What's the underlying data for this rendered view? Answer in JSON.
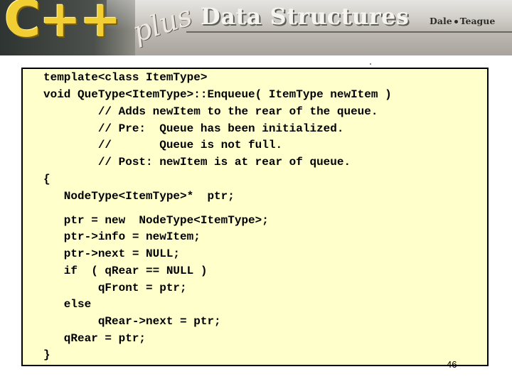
{
  "header": {
    "logo_cpp": "C++",
    "logo_plus": "plus",
    "title": "Data Structures",
    "author_left": "Dale",
    "author_right": "Teague"
  },
  "code": {
    "lines": [
      "template<class ItemType>",
      "void QueType<ItemType>::Enqueue( ItemType newItem )",
      "        // Adds newItem to the rear of the queue.",
      "        // Pre:  Queue has been initialized.",
      "        //       Queue is not full.",
      "        // Post: newItem is at rear of queue.",
      "{",
      "   NodeType<ItemType>*  ptr;",
      "   ptr = new  NodeType<ItemType>;",
      "   ptr->info = newItem;",
      "   ptr->next = NULL;",
      "   if  ( qRear == NULL )",
      "        qFront = ptr;",
      "   else",
      "        qRear->next = ptr;",
      "   qRear = ptr;",
      "}"
    ]
  },
  "page_number": "46"
}
